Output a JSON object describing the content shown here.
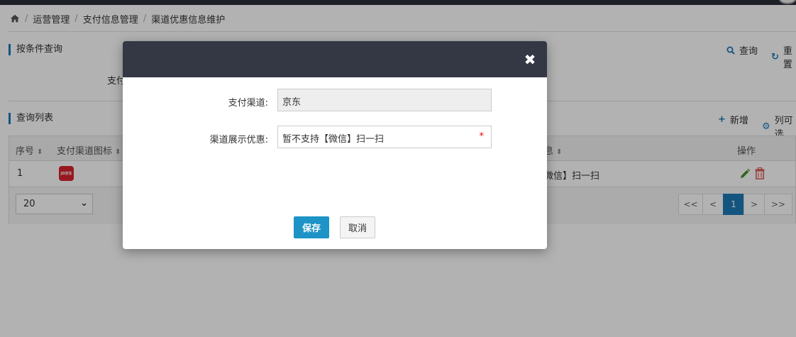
{
  "breadcrumb": {
    "items": [
      "运营管理",
      "支付信息管理",
      "渠道优惠信息维护"
    ],
    "separator": "/"
  },
  "filter_section": {
    "title": "按条件查询",
    "field_label_partial": "支付",
    "search_label": "查询",
    "reset_label": "重置"
  },
  "list_section": {
    "title": "查询列表",
    "add_label": "新增",
    "columns_label": "列可选"
  },
  "table": {
    "headers": {
      "seq": "序号",
      "icon": "支付渠道图标",
      "discount_partial": "息",
      "ops": "操作"
    },
    "rows": [
      {
        "seq": "1",
        "logo_text": "JD京东",
        "discount_partial": "微信】扫一扫"
      }
    ]
  },
  "pagination": {
    "page_size": "20",
    "first": "<<",
    "prev": "<",
    "current": "1",
    "next": ">",
    "last": ">>"
  },
  "modal": {
    "close_symbol": "✖",
    "channel_label": "支付渠道:",
    "channel_value": "京东",
    "discount_label": "渠道展示优惠:",
    "discount_value": "暂不支持【微信】扫一扫",
    "required_mark": "*",
    "save_label": "保存",
    "cancel_label": "取消"
  },
  "colors": {
    "accent": "#1e7ab8",
    "save_button": "#1e93c6",
    "modal_header": "#333844",
    "jd_red": "#d9232e",
    "edit_green": "#4a8f2a",
    "delete_red": "#d9534f"
  }
}
